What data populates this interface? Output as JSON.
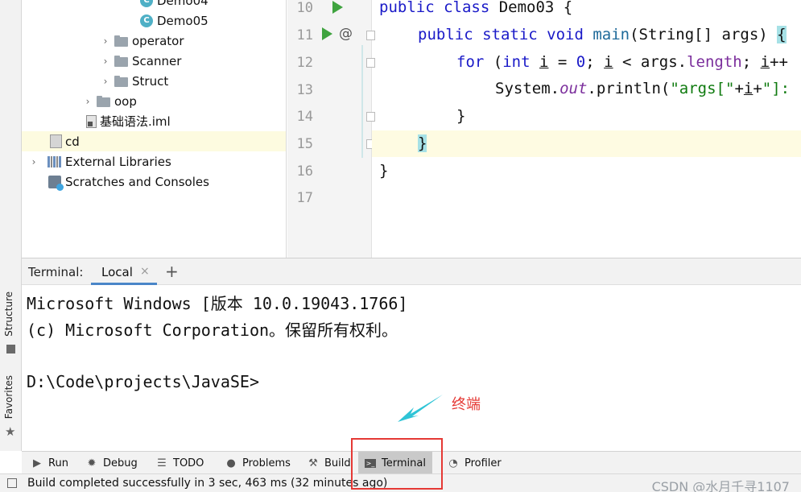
{
  "project_tree": [
    {
      "label": "Demo04",
      "type": "class",
      "chevron": ""
    },
    {
      "label": "Demo05",
      "type": "class",
      "chevron": ""
    },
    {
      "label": "operator",
      "type": "folder",
      "chevron": "›"
    },
    {
      "label": "Scanner",
      "type": "folder",
      "chevron": "›"
    },
    {
      "label": "Struct",
      "type": "folder",
      "chevron": "›"
    },
    {
      "label": "oop",
      "type": "folder",
      "chevron": "›"
    },
    {
      "label": "基础语法.iml",
      "type": "file",
      "chevron": ""
    },
    {
      "label": "cd",
      "type": "cd",
      "chevron": ""
    },
    {
      "label": "External Libraries",
      "type": "lib",
      "chevron": "›"
    },
    {
      "label": "Scratches and Consoles",
      "type": "scratch",
      "chevron": ""
    }
  ],
  "side_tabs": {
    "structure": "Structure",
    "favorites": "Favorites"
  },
  "editor": {
    "line_numbers": [
      "10",
      "11",
      "12",
      "13",
      "14",
      "15",
      "16",
      "17"
    ],
    "at_symbol": "@",
    "code": {
      "l10_kw": "public class ",
      "l10_rest": "Demo03 {",
      "l11_kw": "public static void ",
      "l11_fn": "main",
      "l11_rest": "(String[] args) ",
      "l11_brace": "{",
      "l12_kw1": "for",
      "l12_a": " (",
      "l12_kw2": "int",
      "l12_b": " ",
      "l12_i1": "i",
      "l12_c": " = ",
      "l12_num": "0",
      "l12_d": "; ",
      "l12_i2": "i",
      "l12_e": " < args.",
      "l12_fld": "length",
      "l12_f": "; ",
      "l12_i3": "i",
      "l12_g": "++",
      "l13_a": "System.",
      "l13_out": "out",
      "l13_b": ".println(",
      "l13_s1": "\"args[\"",
      "l13_c": "+",
      "l13_i": "i",
      "l13_d": "+",
      "l13_s2": "\"]:",
      "l14": "}",
      "l15": "}",
      "l16": "}"
    }
  },
  "terminal": {
    "title": "Terminal:",
    "tab_label": "Local",
    "tab_close": "×",
    "add_tab": "+",
    "lines": [
      "Microsoft Windows [版本 10.0.19043.1766]",
      "(c) Microsoft Corporation。保留所有权利。",
      "",
      "D:\\Code\\projects\\JavaSE>"
    ]
  },
  "tool_tabs": [
    {
      "label": "Run",
      "icon": "▶"
    },
    {
      "label": "Debug",
      "icon": "✹"
    },
    {
      "label": "TODO",
      "icon": "☰"
    },
    {
      "label": "Problems",
      "icon": "●"
    },
    {
      "label": "Build",
      "icon": "⚒"
    },
    {
      "label": "Terminal",
      "icon": ">_"
    },
    {
      "label": "Profiler",
      "icon": "◔"
    }
  ],
  "status": {
    "message": "Build completed successfully in 3 sec, 463 ms (32 minutes ago)",
    "watermark": "CSDN @水月千寻1107"
  },
  "annotation": {
    "label": "终端",
    "color": "#e53935",
    "arrow_color": "#2fc4d6"
  },
  "colors": {
    "keyword": "#1a1ac8",
    "string": "#0e7a0e",
    "field": "#7b2e9c",
    "accent": "#4a86c8",
    "run_green": "#3fa33f"
  }
}
